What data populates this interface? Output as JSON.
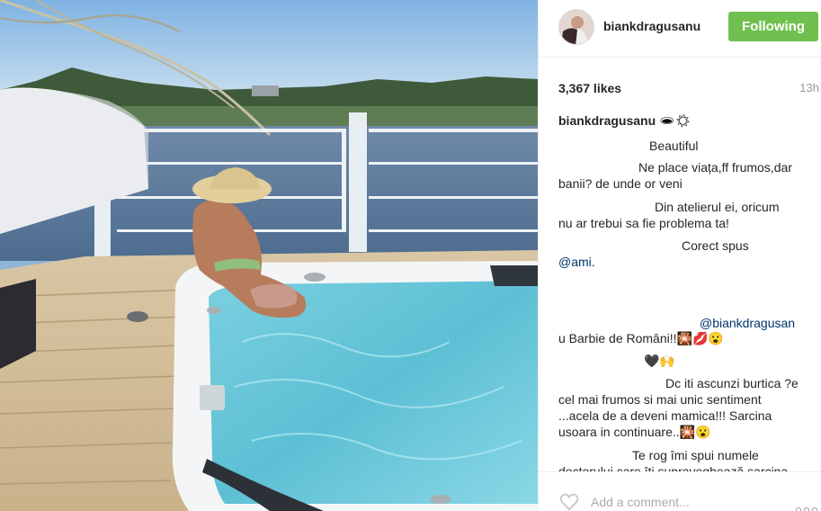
{
  "post": {
    "username": "biankdragusanu",
    "follow_label": "Following",
    "likes": "3,367 likes",
    "time": "13h"
  },
  "comments": [
    {
      "author": "biankdragusanu",
      "text": "🕳☀"
    },
    {
      "text": "Beautiful"
    },
    {
      "text": "Ne place viața,ff frumos,dar"
    },
    {
      "text": "banii? de unde or veni"
    },
    {
      "text": "Din atelierul ei, oricum"
    },
    {
      "text": "nu ar trebui sa fie problema ta!"
    },
    {
      "text": "Corect spus"
    },
    {
      "mention": "@ami."
    },
    {
      "mention": "@biankdragusan"
    },
    {
      "text": "u Barbie de Români!!🎇💋😮"
    },
    {
      "text": "🖤🙌"
    },
    {
      "text": "Dc iti ascunzi burtica ?e"
    },
    {
      "text": "cel mai frumos si mai unic sentiment"
    },
    {
      "text": "...acela de a deveni mamica!!! Sarcina"
    },
    {
      "text": "usoara in continuare..🎇😮"
    },
    {
      "text": "Te rog îmi spui numele"
    },
    {
      "text": "doctorului care îți supraveghează sarcina"
    }
  ],
  "footer": {
    "add_comment_placeholder": "Add a comment..."
  },
  "colors": {
    "follow_button": "#70c050",
    "mention": "#003569"
  },
  "icons": [
    "heart-icon",
    "more-options-icon"
  ]
}
